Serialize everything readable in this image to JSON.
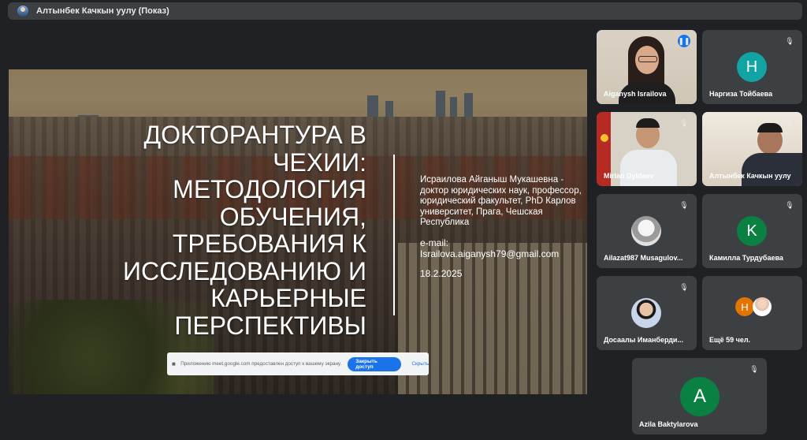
{
  "header": {
    "presenter_title": "Алтынбек Качкын уулу (Показ)"
  },
  "slide": {
    "title": "ДОКТОРАНТУРА В ЧЕХИИ: МЕТОДОЛОГИЯ ОБУЧЕНИЯ, ТРЕБОВАНИЯ К ИССЛЕДОВАНИЮ И КАРЬЕРНЫЕ ПЕРСПЕКТИВЫ",
    "author": "Исраилова Айганыш Мукашевна - доктор юридических наук, профессор, юридический факультет, PhD Карлов университет, Прага, Чешская Республика",
    "email_label": "e-mail:",
    "email": "Israilova.aiganysh79@gmail.com",
    "date": "18.2.2025"
  },
  "permission_bar": {
    "message": "Приложению meet.google.com предоставлен доступ к вашему экрану.",
    "allow_label": "Закрыть доступ",
    "hide_label": "Скрыть"
  },
  "participants": [
    {
      "name": "Aiganysh Israilova",
      "state": "speaking"
    },
    {
      "name": "Наргиза Тойбаева",
      "initial": "H",
      "color": "#12a4a4",
      "state": "muted"
    },
    {
      "name": "Mirlan Dyldaev",
      "state": "muted"
    },
    {
      "name": "Алтынбек Качкын уулу",
      "state": "muted"
    },
    {
      "name": "Ailazat987 Musagulov...",
      "state": "muted"
    },
    {
      "name": "Камилла Турдубаева",
      "initial": "K",
      "color": "#0b8043",
      "state": "muted"
    },
    {
      "name": "Досаалы Иманберди...",
      "state": "muted"
    },
    {
      "name": "Ещё 59 чел.",
      "initial": "H",
      "color": "#e37400"
    },
    {
      "name": "Azila Baktylarova",
      "initial": "A",
      "color": "#0b8043",
      "state": "muted"
    }
  ],
  "icons": {
    "muted": "mic-off-icon",
    "speaking": "audio-wave-icon"
  }
}
